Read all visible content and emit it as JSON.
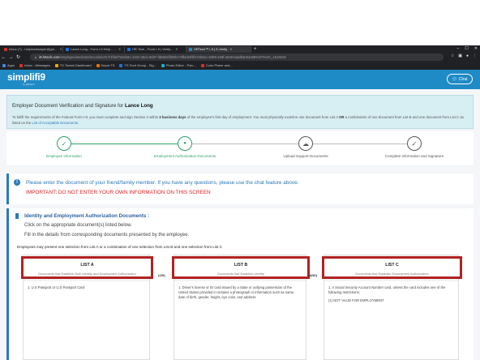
{
  "browser": {
    "tabs": [
      {
        "label": "Inbox (7) - helpmarkwayer@gm...",
        "color": "#d93025",
        "active": false
      },
      {
        "label": "Lance Long - Form I-9 Help - ...",
        "color": "#1a73e8",
        "active": false
      },
      {
        "label": "HR Tech - Form I-9 | Verify...",
        "color": "#1a73e8",
        "active": false
      },
      {
        "label": "HRTech™ I-9 | E-Verify",
        "color": "#1f8bc6",
        "active": true
      }
    ],
    "new_tab": "+",
    "url_host": "i9.hrtech.com",
    "url_path": "/employee/section2/records/1217/1f0af7e6d16c-1c62-45ce-9d37-fd65b2fd28b1?2fbeb4fbf17eb61c-6399-4e8f-a0e8-baaf53e54a56%2Ft%2C_1618102",
    "bookmarks": [
      {
        "label": "Apps",
        "color": "#4285f4"
      },
      {
        "label": "Inbox - Messages",
        "color": "#d93025"
      },
      {
        "label": "TS Tomah Dashboard",
        "color": "#f9ab00"
      },
      {
        "label": "Depot TS",
        "color": "#e8710a"
      },
      {
        "label": "TS Tech Group - Sig...",
        "color": "#1a73e8"
      },
      {
        "label": "Photo Editor - Polo...",
        "color": "#12b5cb"
      },
      {
        "label": "Color Picker and...",
        "color": "#d93025"
      }
    ]
  },
  "app": {
    "logo": "simplifi9",
    "logo_sub": "by HRTech",
    "chat_label": "Chat"
  },
  "banner": {
    "title_prefix": "Employer Document Verification and Signature for",
    "employee_name": "Lance Long",
    "text_start": "To fulfill the requirements of the Federal Form I-9, you must complete and sign Section 2 within",
    "text_bold": "3 business days",
    "text_mid": "of the employee's first day of employment. You must physically examine one document from List A",
    "text_or": "OR",
    "text_end": "a combination of one document from List B and one document from List C as listed on the",
    "link": "List of Acceptable Documents."
  },
  "steps": [
    {
      "label": "Employee Information",
      "state": "done"
    },
    {
      "label": "Employment Authorization Documents",
      "state": "current"
    },
    {
      "label": "Upload Support Documents",
      "state": "todo"
    },
    {
      "label": "Complete Information and Signature",
      "state": "todo"
    }
  ],
  "notice": {
    "line1": "Please enter the document of your friend/family member. If you have any questions, please use the chat feature above.",
    "line2": "IMPORTANT: DO NOT ENTER YOUR OWN INFORMATION ON THIS SCREEN"
  },
  "identity": {
    "title": "Identity and Employment Authorization Documents :",
    "sub1": "Click on the appropriate document(s) listed below.",
    "sub2": "Fill in the details from corresponding documents presented by the employee.",
    "intro": "Employees may present one selection from List A or a combination of one selection from List B and one selection from List C",
    "or_label": "(OR)",
    "and_label": "(AND)",
    "lists": [
      {
        "title": "LIST A",
        "desc": "Documents that Establish Both Identity and Employment Authorization",
        "items": [
          "1. U.S Passport or U.S Passport Card"
        ]
      },
      {
        "title": "LIST B",
        "desc": "Documents that Establish Identity",
        "items": [
          "1. Driver's license or ID card issued by a State or outlying possession of the United States provided it contains a photograph or information such as name, date of birth, gender, height, eye color, and address"
        ]
      },
      {
        "title": "LIST C",
        "desc": "Documents that Establish Employment Authorization",
        "items": [
          "1. A Social Security Account Number card, unless the card includes one of the following restrictions:",
          "(1) NOT VALID FOR EMPLOYMENT"
        ]
      }
    ]
  },
  "colors": {
    "brand": "#1f8bc6",
    "step_done": "#2e9f6b",
    "step_todo": "#555555",
    "highlight_border": "#b22222",
    "important": "#e02020"
  }
}
